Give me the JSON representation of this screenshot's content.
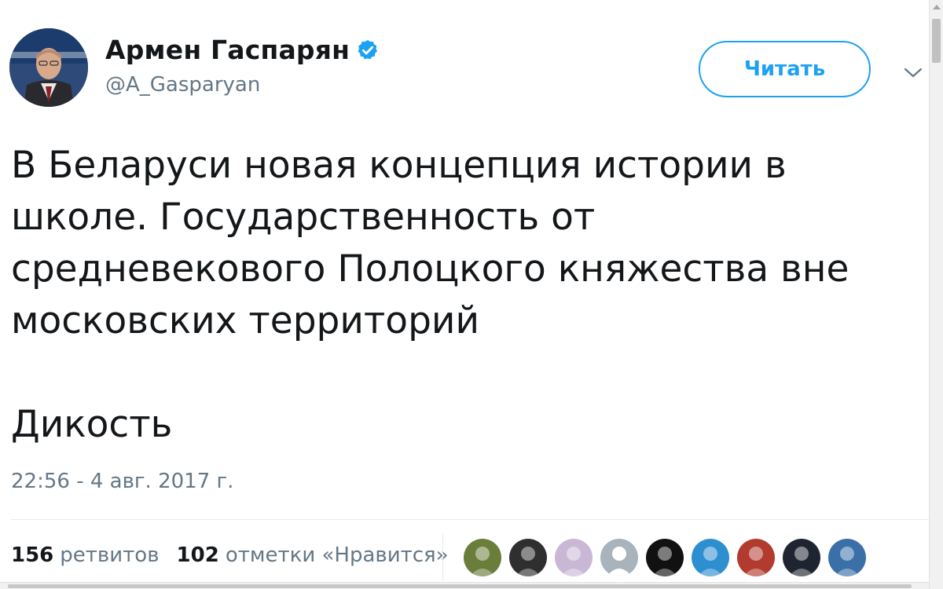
{
  "author": {
    "display_name": "Армен Гаспарян",
    "handle": "@A_Gasparyan",
    "verified": true
  },
  "follow_button": {
    "label": "Читать"
  },
  "tweet": {
    "text": "В Беларуси новая концепция истории в\nшколе. Государственность от\nсредневекового Полоцкого княжества вне\nмосковских территорий",
    "text_2": "Дикость",
    "timestamp": "22:56 - 4 авг. 2017 г."
  },
  "stats": {
    "retweets_count": "156",
    "retweets_label": "ретвитов",
    "likes_count": "102",
    "likes_label": "отметки «Нравится»"
  },
  "likers": [
    {
      "icon": "liker-avatar",
      "color": "#6b7d3a"
    },
    {
      "icon": "liker-avatar",
      "color": "#2f2f2f"
    },
    {
      "icon": "liker-avatar",
      "color": "#c9b7d6"
    },
    {
      "icon": "liker-avatar",
      "color": "#a9b3bb"
    },
    {
      "icon": "liker-avatar",
      "color": "#111111"
    },
    {
      "icon": "liker-avatar",
      "color": "#2e8fd0"
    },
    {
      "icon": "liker-avatar",
      "color": "#b23a2e"
    },
    {
      "icon": "liker-avatar",
      "color": "#1f2530"
    },
    {
      "icon": "liker-avatar",
      "color": "#3a6fa8"
    }
  ],
  "colors": {
    "accent": "#1da1f2",
    "text": "#14171a",
    "muted": "#657786",
    "divider": "#e6ecf0"
  }
}
